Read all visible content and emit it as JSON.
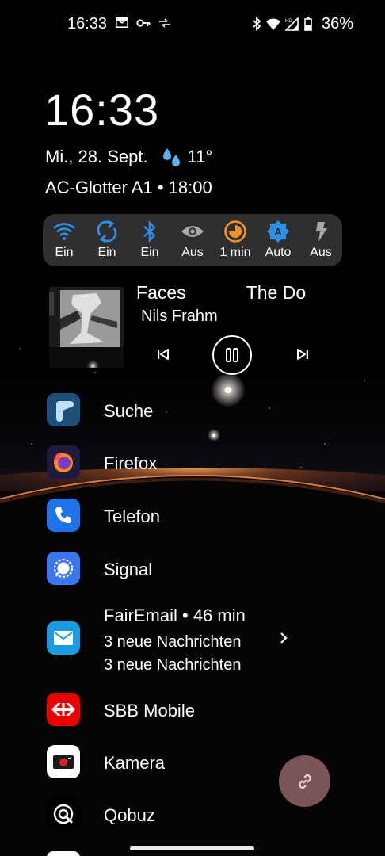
{
  "status_bar": {
    "time": "16:33",
    "left_icons": [
      "mail-icon",
      "key-icon",
      "data-transfer-icon"
    ],
    "right_icons": [
      "bluetooth-icon",
      "wifi-icon",
      "signal-hd-icon",
      "battery-icon"
    ],
    "battery": "36%"
  },
  "clock": {
    "time": "16:33"
  },
  "date": {
    "text": "Mi., 28. Sept.",
    "weather_icon": "raindrops-icon",
    "temperature": "11°"
  },
  "event": {
    "text": "AC-Glotter A1 • 18:00"
  },
  "toggles": [
    {
      "name": "wifi",
      "icon": "wifi-icon",
      "label": "Ein",
      "color": "#2f8de4"
    },
    {
      "name": "sync",
      "icon": "sync-icon",
      "label": "Ein",
      "color": "#2f8de4"
    },
    {
      "name": "bluetooth",
      "icon": "bluetooth-icon",
      "label": "Ein",
      "color": "#2f8de4"
    },
    {
      "name": "eye-comfort",
      "icon": "eye-icon",
      "label": "Aus",
      "color": "#a8a8a8"
    },
    {
      "name": "screen-timeout",
      "icon": "timer-icon",
      "label": "1 min",
      "color": "#f0932b"
    },
    {
      "name": "auto-brightness",
      "icon": "auto-brightness-icon",
      "label": "Auto",
      "color": "#2f8de4"
    },
    {
      "name": "flashlight",
      "icon": "flashlight-icon",
      "label": "Aus",
      "color": "#a8a8a8"
    }
  ],
  "media": {
    "title_visible": ") Faces",
    "title_next": "The Do",
    "artist": "Nils Frahm",
    "controls": [
      "skip-previous-icon",
      "pause-icon",
      "skip-next-icon"
    ]
  },
  "apps": [
    {
      "name": "suche",
      "label": "Suche",
      "icon": "search-app-icon",
      "color": "#1a5f8f"
    },
    {
      "name": "firefox",
      "label": "Firefox",
      "icon": "firefox-icon",
      "color": "#1f1b3f"
    },
    {
      "name": "telefon",
      "label": "Telefon",
      "icon": "phone-icon",
      "color": "#1e73e8"
    },
    {
      "name": "signal",
      "label": "Signal",
      "icon": "signal-app-icon",
      "color": "#3a76f0"
    },
    {
      "name": "fairemail",
      "label": "FairEmail • 46 min",
      "icon": "mail-app-icon",
      "color": "#1a9ae0",
      "sub1": "3 neue Nachrichten",
      "sub2": "3 neue Nachrichten"
    },
    {
      "name": "sbb",
      "label": "SBB Mobile",
      "icon": "sbb-icon",
      "color": "#eb0000"
    },
    {
      "name": "kamera",
      "label": "Kamera",
      "icon": "camera-icon",
      "color": "#ffffff"
    },
    {
      "name": "qobuz",
      "label": "Qobuz",
      "icon": "qobuz-icon",
      "color": "#000000"
    }
  ],
  "fab": {
    "icon": "link-icon",
    "color": "#7a5558"
  }
}
